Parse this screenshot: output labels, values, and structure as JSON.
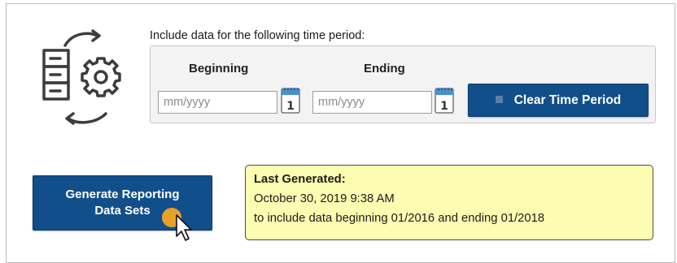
{
  "period": {
    "caption": "Include data for the following time period:",
    "begin_label": "Beginning",
    "end_label": "Ending",
    "begin_placeholder": "mm/yyyy",
    "end_placeholder": "mm/yyyy",
    "calendar_day": "1",
    "clear_label": "Clear Time Period"
  },
  "generate": {
    "label_line1": "Generate Reporting",
    "label_line2": "Data Sets"
  },
  "last_generated": {
    "title": "Last Generated:",
    "date": "October 30, 2019 9:38 AM",
    "range": "to include data beginning 01/2016 and ending 01/2018"
  },
  "colors": {
    "primary_button": "#114f8b",
    "note_background": "#fdfdb2",
    "cursor_highlight": "#f5a623"
  }
}
